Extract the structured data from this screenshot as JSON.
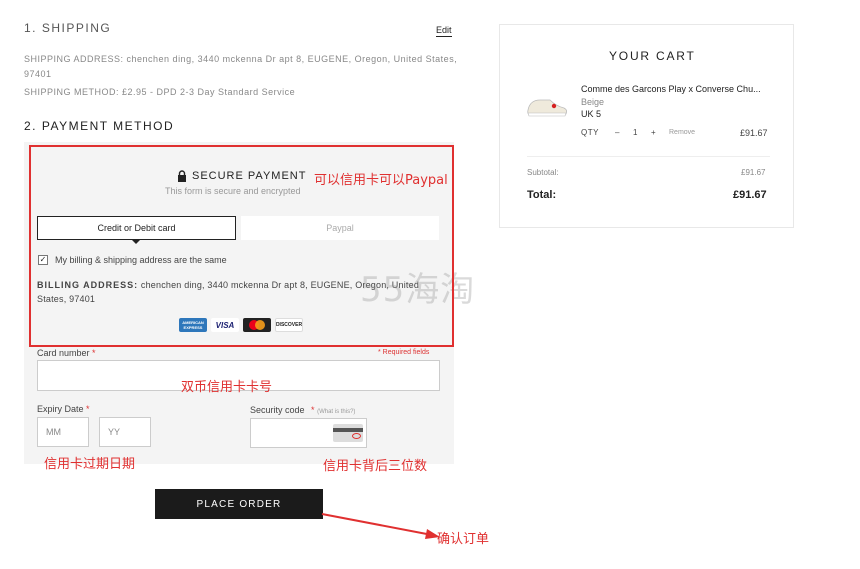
{
  "shipping": {
    "title": "1. SHIPPING",
    "edit_label": "Edit",
    "address_line1": "SHIPPING ADDRESS: chenchen ding, 3440 mckenna Dr apt 8, EUGENE, Oregon, United States,",
    "address_line2": "97401",
    "method": "SHIPPING METHOD: £2.95 - DPD 2-3 Day Standard Service"
  },
  "payment": {
    "title": "2. PAYMENT METHOD",
    "secure_title": "SECURE PAYMENT",
    "secure_sub": "This form is secure and encrypted",
    "tab_card": "Credit or Debit card",
    "tab_paypal": "Paypal",
    "same_address_label": "My billing & shipping address are the same",
    "billing_label": "BILLING ADDRESS:",
    "billing_line1": "chenchen ding, 3440 mckenna Dr apt 8, EUGENE, Oregon, United",
    "billing_line2": "States, 97401",
    "card_logos": [
      "AMERICAN EXPRESS",
      "VISA",
      "mastercard",
      "DISCOVER"
    ],
    "card_number_label": "Card number",
    "required_star": "*",
    "required_note": "* Required fields",
    "expiry_label": "Expiry Date",
    "mm_placeholder": "MM",
    "yy_placeholder": "YY",
    "security_label": "Security code",
    "what_is_this": "(What is this?)",
    "place_order": "PLACE ORDER"
  },
  "cart": {
    "title": "YOUR CART",
    "product_name": "Comme des Garcons Play x Converse Chu...",
    "color": "Beige",
    "size": "UK 5",
    "qty_label": "QTY",
    "qty_minus": "–",
    "qty_value": "1",
    "qty_plus": "+",
    "remove": "Remove",
    "item_price": "£91.67",
    "subtotal_label": "Subtotal:",
    "subtotal_value": "£91.67",
    "total_label": "Total:",
    "total_value": "£91.67"
  },
  "annotations": {
    "card_or_paypal": "可以信用卡可以Paypal",
    "dual_currency_card": "双币信用卡卡号",
    "expiry_date": "信用卡过期日期",
    "cvv": "信用卡背后三位数",
    "confirm_order": "确认订单"
  },
  "watermark": "55海淘",
  "colors": {
    "accent_red": "#e03030",
    "button_dark": "#1b1b1b",
    "panel_bg": "#f4f4f4"
  }
}
